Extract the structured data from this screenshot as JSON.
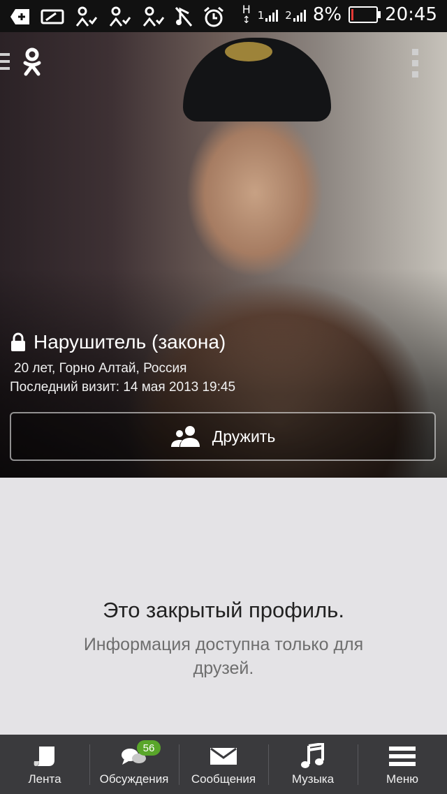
{
  "status_bar": {
    "battery_percent": "8%",
    "time": "20:45",
    "network_type": "H",
    "sim1_label": "1",
    "sim2_label": "2",
    "battery_level": 0.08,
    "battery_color": "#e53935"
  },
  "header": {
    "logo_icon": "ok-logo-icon",
    "menu_icon": "overflow-menu-icon"
  },
  "profile": {
    "name": "Нарушитель (закона)",
    "age_location": "20 лет, Горно Алтай, Россия",
    "last_visit": "Последний визит: 14 мая 2013 19:45",
    "privacy_icon": "lock-icon",
    "friend_button_label": "Дружить",
    "friend_button_icon": "friends-icon"
  },
  "closed_profile": {
    "title": "Это закрытый профиль.",
    "subtitle": "Информация доступна только для друзей."
  },
  "bottom_nav": {
    "items": [
      {
        "label": "Лента",
        "icon": "feed-icon"
      },
      {
        "label": "Обсуждения",
        "icon": "discussions-icon",
        "badge": "56"
      },
      {
        "label": "Сообщения",
        "icon": "messages-icon"
      },
      {
        "label": "Музыка",
        "icon": "music-icon"
      },
      {
        "label": "Меню",
        "icon": "menu-icon"
      }
    ],
    "badge_color": "#59a62a"
  }
}
